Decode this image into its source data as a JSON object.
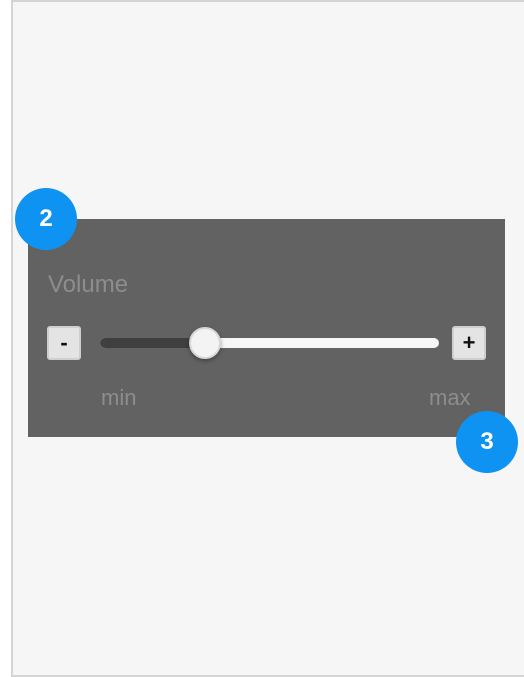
{
  "app": {
    "screen_name": "",
    "background_color": "#f6f6f6"
  },
  "volume_control": {
    "label": "Volume",
    "min_label": "min",
    "max_label": "max",
    "decrement_label": "-",
    "increment_label": "+",
    "value_fraction": 0.31,
    "panel_color": "#626262",
    "track_empty_color": "#f6f6f6",
    "track_filled_color": "#3f3f3f"
  },
  "annotations": [
    {
      "label": "2",
      "color": "#0f93f2"
    },
    {
      "label": "3",
      "color": "#0f93f2"
    }
  ]
}
